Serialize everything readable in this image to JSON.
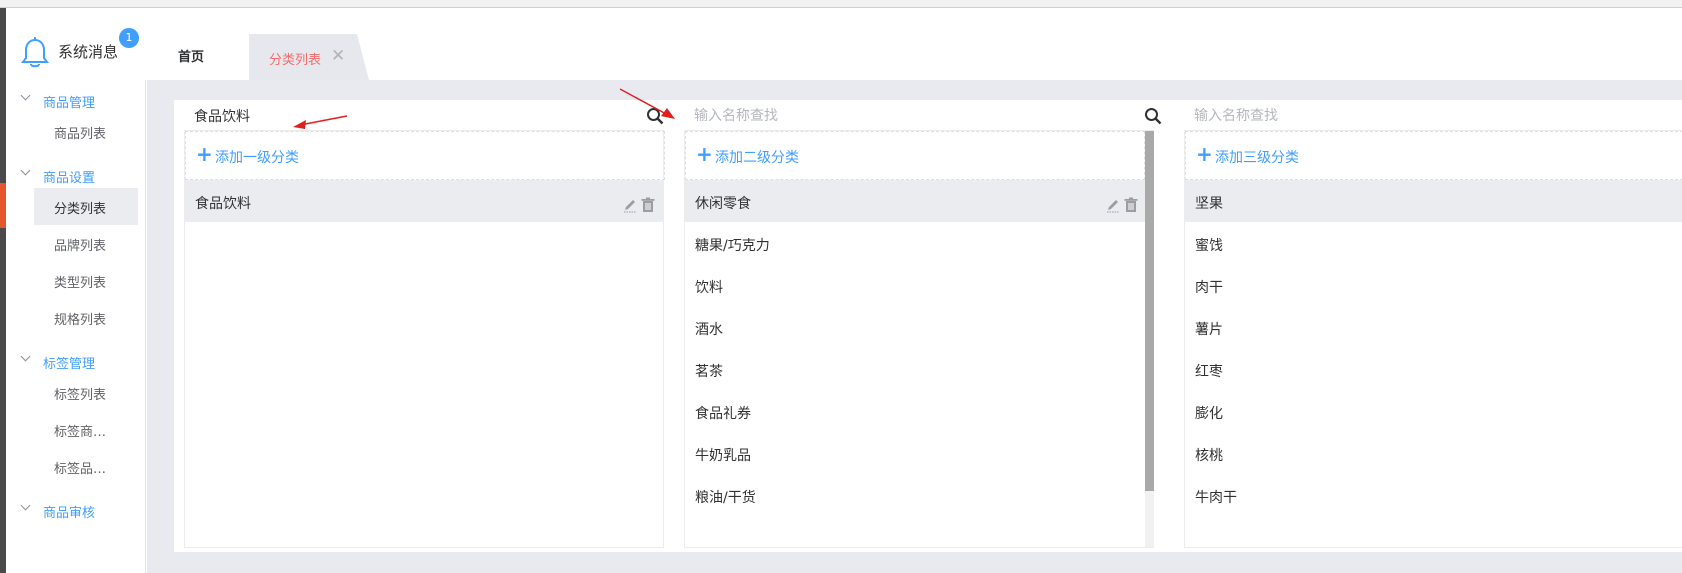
{
  "header": {
    "notification_label": "系统消息",
    "notification_count": "1",
    "tabs": [
      {
        "label": "首页",
        "active": false
      },
      {
        "label": "分类列表",
        "active": true
      }
    ]
  },
  "sidebar": {
    "groups": [
      {
        "label": "商品管理",
        "items": [
          "商品列表"
        ]
      },
      {
        "label": "商品设置",
        "items": [
          "分类列表",
          "品牌列表",
          "类型列表",
          "规格列表"
        ]
      },
      {
        "label": "标签管理",
        "items": [
          "标签列表",
          "标签商…",
          "标签品…"
        ]
      },
      {
        "label": "商品审核",
        "items": []
      }
    ],
    "active_item": "分类列表"
  },
  "columns": [
    {
      "search_value": "食品饮料",
      "search_placeholder": "",
      "add_label": "添加一级分类",
      "items": [
        "食品饮料"
      ]
    },
    {
      "search_value": "",
      "search_placeholder": "输入名称查找",
      "add_label": "添加二级分类",
      "items": [
        "休闲零食",
        "糖果/巧克力",
        "饮料",
        "酒水",
        "茗茶",
        "食品礼券",
        "牛奶乳品",
        "粮油/干货"
      ]
    },
    {
      "search_value": "",
      "search_placeholder": "输入名称查找",
      "add_label": "添加三级分类",
      "items": [
        "坚果",
        "蜜饯",
        "肉干",
        "薯片",
        "红枣",
        "膨化",
        "核桃",
        "牛肉干"
      ]
    }
  ],
  "colors": {
    "accent": "#409eff",
    "active_tab": "#f56c6c",
    "annotation": "#e02020"
  }
}
